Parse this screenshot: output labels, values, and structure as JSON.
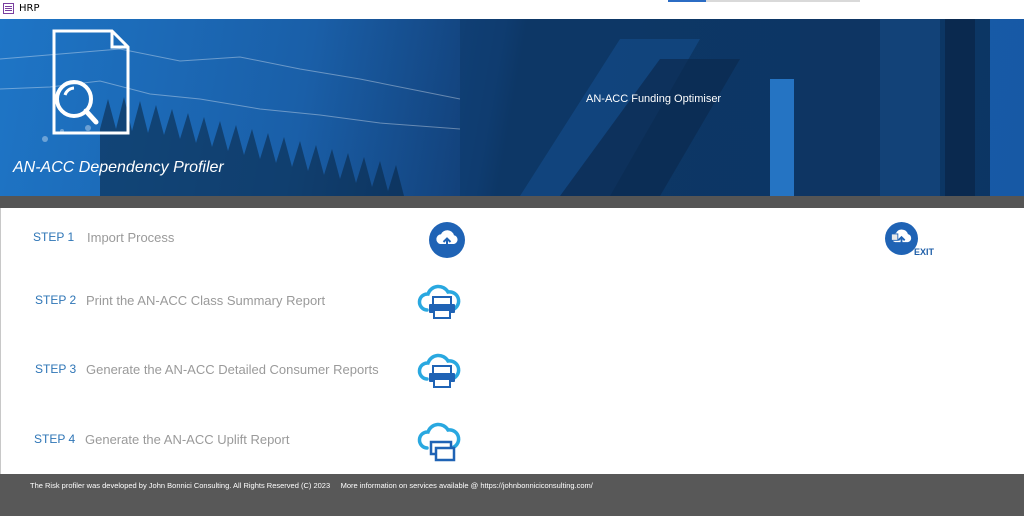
{
  "window": {
    "title": "HRP"
  },
  "banner": {
    "left_title": "AN-ACC Dependency Profiler",
    "right_title": "AN-ACC Funding Optimiser"
  },
  "steps": [
    {
      "label": "STEP 1",
      "text": "Import Process",
      "icon": "cloud-upload-icon"
    },
    {
      "label": "STEP 2",
      "text": "Print the AN-ACC Class Summary Report",
      "icon": "cloud-print-icon"
    },
    {
      "label": "STEP 3",
      "text": "Generate the AN-ACC Detailed Consumer Reports",
      "icon": "cloud-print-icon"
    },
    {
      "label": "STEP 4",
      "text": "Generate the AN-ACC  Uplift Report",
      "icon": "cloud-report-icon"
    }
  ],
  "exit": {
    "label": "EXIT",
    "icon": "cloud-exit-icon"
  },
  "footer": {
    "text": "The Risk profiler was developed by John Bonnici Consulting. All Rights Reserved (C) 2023     More information on services available @ https://johnbonniciconsulting.com/"
  },
  "colors": {
    "banner_blue": "#1e75c6",
    "banner_dark": "#0c2f59",
    "step_label": "#2e75b6",
    "step_text": "#9a9a9a",
    "footer_bg": "#585858",
    "icon_blue": "#1f63b5",
    "icon_cyan": "#29a8e0"
  }
}
